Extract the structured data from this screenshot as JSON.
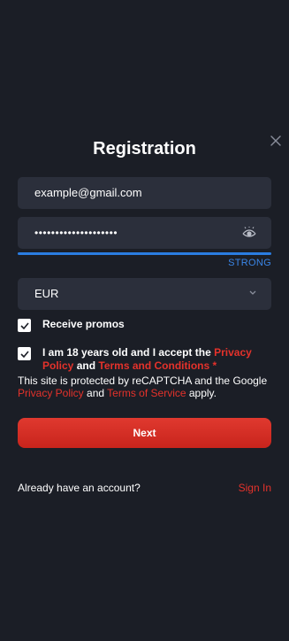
{
  "modal": {
    "title": "Registration",
    "close_icon": "close-icon"
  },
  "form": {
    "email_value": "example@gmail.com",
    "password_value": "••••••••••••••••••••",
    "password_strength": "STRONG",
    "password_strength_color": "#2a7de1",
    "currency_value": "EUR",
    "receive_promos_label": "Receive promos",
    "receive_promos_checked": true,
    "age_prefix": "I am 18 years old and I accept the ",
    "age_privacy_link": "Privacy Policy",
    "age_and": " and ",
    "age_terms_link": "Terms and Conditions",
    "age_required_mark": " *",
    "age_checked": true
  },
  "recaptcha": {
    "prefix": "This site is protected by reCAPTCHA and the Google ",
    "privacy_link": "Privacy Policy",
    "and": " and ",
    "terms_link": "Terms of Service",
    "suffix": " apply."
  },
  "actions": {
    "next_label": "Next"
  },
  "footer": {
    "question": "Already have an account?",
    "sign_in_link": "Sign In"
  },
  "colors": {
    "background": "#1b1e26",
    "field": "#2b2f3b",
    "accent_red": "#e4322b",
    "accent_blue": "#2a7de1"
  }
}
